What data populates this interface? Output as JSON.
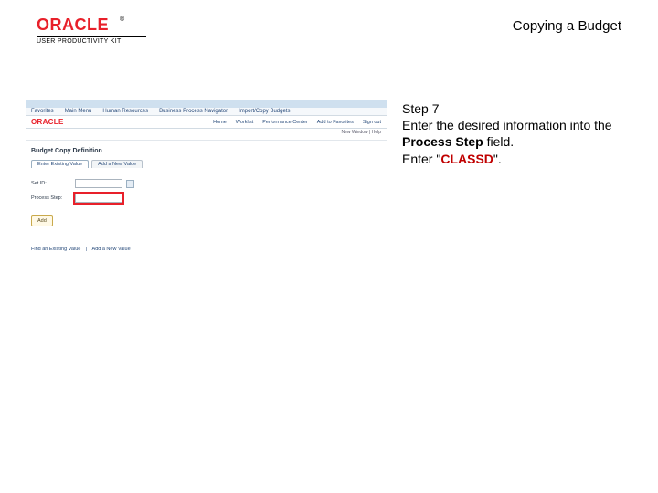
{
  "header": {
    "logo_text": "ORACLE",
    "logo_tm": "®",
    "subbrand": "USER PRODUCTIVITY KIT",
    "doc_title": "Copying a Budget"
  },
  "screenshot": {
    "nav_items": [
      "Favorites",
      "Main Menu",
      "Human Resources",
      "Business Process Navigator",
      "Import/Copy Budgets"
    ],
    "mini_logo": "ORACLE",
    "tabs": [
      "Home",
      "Worklist",
      "Performance Center",
      "Add to Favorites",
      "Sign out"
    ],
    "meta_right": "New Window | Help",
    "page_heading": "Budget Copy Definition",
    "subtabs": {
      "active": "Enter Existing Value",
      "other": "Add a New Value"
    },
    "fields": {
      "setid": {
        "label": "Set ID:",
        "value": ""
      },
      "process_step": {
        "label": "Process Step:",
        "value": ""
      }
    },
    "add_button": "Add",
    "footer": [
      "Find an Existing Value",
      "|",
      "Add a New Value"
    ]
  },
  "instruction": {
    "step_label": "Step 7",
    "line1_a": "Enter the desired information into the ",
    "line1_b": "Process Step",
    "line1_c": " field.",
    "line2_a": "Enter \"",
    "line2_b": "CLASSD",
    "line2_c": "\"."
  }
}
